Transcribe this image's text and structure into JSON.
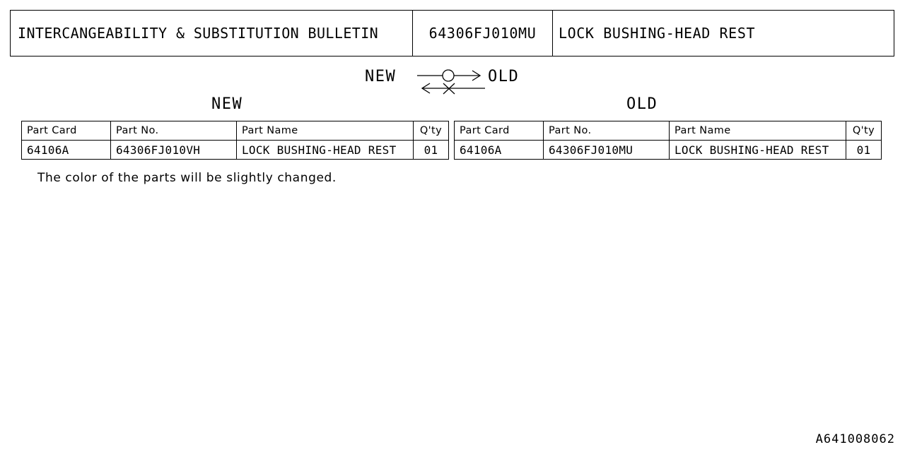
{
  "header": {
    "title": "INTERCANGEABILITY & SUBSTITUTION BULLETIN",
    "part_number": "64306FJ010MU",
    "part_name": "LOCK BUSHING-HEAD REST"
  },
  "legend": {
    "left_label": "NEW",
    "right_label": "OLD",
    "forward_symbol": "circle",
    "reverse_symbol": "cross",
    "forward_icon": "arrow-right-icon",
    "reverse_icon": "arrow-left-icon"
  },
  "sections": {
    "new_caption": "NEW",
    "old_caption": "OLD"
  },
  "tables": {
    "columns": [
      "Part Card",
      "Part No.",
      "Part Name",
      "Q'ty"
    ],
    "new": {
      "rows": [
        {
          "part_card": "64106A",
          "part_no": "64306FJ010VH",
          "part_name": "LOCK BUSHING-HEAD REST",
          "qty": "01"
        }
      ]
    },
    "old": {
      "rows": [
        {
          "part_card": "64106A",
          "part_no": "64306FJ010MU",
          "part_name": "LOCK BUSHING-HEAD REST",
          "qty": "01"
        }
      ]
    }
  },
  "note": "The color of the parts will be slightly changed.",
  "footer": {
    "reference": "A641008062"
  },
  "colors": {
    "ink": "#000000",
    "paper": "#ffffff"
  }
}
